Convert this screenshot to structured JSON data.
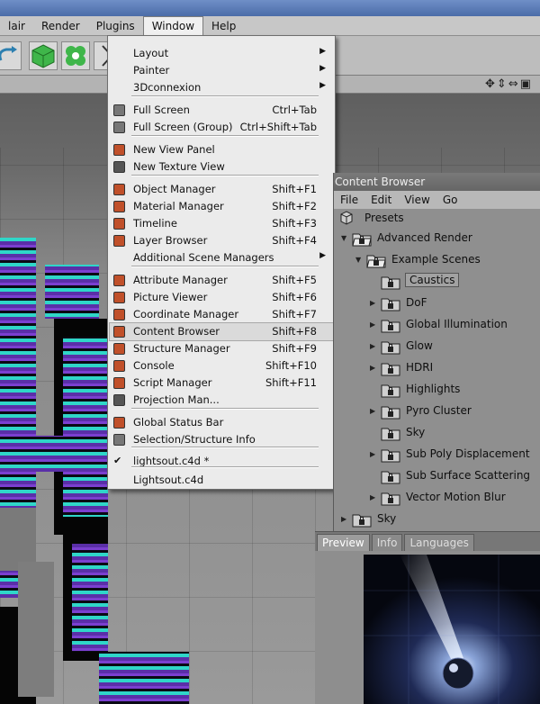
{
  "menubar": {
    "items": [
      "lair",
      "Render",
      "Plugins",
      "Window",
      "Help"
    ],
    "active": "Window"
  },
  "window_menu": {
    "items": [
      {
        "label": "Layout",
        "shortcut": "",
        "submenu": true,
        "icon": ""
      },
      {
        "label": "Painter",
        "shortcut": "",
        "submenu": true,
        "icon": ""
      },
      {
        "label": "3Dconnexion",
        "shortcut": "",
        "submenu": true,
        "icon": ""
      },
      {
        "label": "Full Screen",
        "shortcut": "Ctrl+Tab",
        "submenu": false,
        "icon": "fullscreen-icon"
      },
      {
        "label": "Full Screen (Group)",
        "shortcut": "Ctrl+Shift+Tab",
        "submenu": false,
        "icon": "fullscreen-group-icon"
      },
      {
        "label": "New View Panel",
        "shortcut": "",
        "submenu": false,
        "icon": "view-panel-icon"
      },
      {
        "label": "New Texture View",
        "shortcut": "",
        "submenu": false,
        "icon": "texture-view-icon"
      },
      {
        "label": "Object Manager",
        "shortcut": "Shift+F1",
        "submenu": false,
        "icon": "object-manager-icon"
      },
      {
        "label": "Material Manager",
        "shortcut": "Shift+F2",
        "submenu": false,
        "icon": "material-manager-icon"
      },
      {
        "label": "Timeline",
        "shortcut": "Shift+F3",
        "submenu": false,
        "icon": "timeline-icon"
      },
      {
        "label": "Layer Browser",
        "shortcut": "Shift+F4",
        "submenu": false,
        "icon": "layer-browser-icon"
      },
      {
        "label": "Additional Scene Managers",
        "shortcut": "",
        "submenu": true,
        "icon": ""
      },
      {
        "label": "Attribute Manager",
        "shortcut": "Shift+F5",
        "submenu": false,
        "icon": "attribute-manager-icon"
      },
      {
        "label": "Picture Viewer",
        "shortcut": "Shift+F6",
        "submenu": false,
        "icon": "picture-viewer-icon"
      },
      {
        "label": "Coordinate Manager",
        "shortcut": "Shift+F7",
        "submenu": false,
        "icon": "coordinate-manager-icon"
      },
      {
        "label": "Content Browser",
        "shortcut": "Shift+F8",
        "submenu": false,
        "icon": "content-browser-icon"
      },
      {
        "label": "Structure Manager",
        "shortcut": "Shift+F9",
        "submenu": false,
        "icon": "structure-manager-icon"
      },
      {
        "label": "Console",
        "shortcut": "Shift+F10",
        "submenu": false,
        "icon": "console-icon"
      },
      {
        "label": "Script Manager",
        "shortcut": "Shift+F11",
        "submenu": false,
        "icon": "script-manager-icon"
      },
      {
        "label": "Projection Man...",
        "shortcut": "",
        "submenu": false,
        "icon": "projection-man-icon"
      },
      {
        "label": "Global Status Bar",
        "shortcut": "",
        "submenu": false,
        "icon": "status-bar-icon"
      },
      {
        "label": "Selection/Structure Info",
        "shortcut": "",
        "submenu": false,
        "icon": "selection-info-icon"
      },
      {
        "label": "lightsout.c4d *",
        "shortcut": "",
        "submenu": false,
        "icon": "checkmark-icon"
      },
      {
        "label": "Lightsout.c4d",
        "shortcut": "",
        "submenu": false,
        "icon": ""
      }
    ],
    "highlighted": "Content Browser"
  },
  "content_browser": {
    "title": "Content Browser",
    "menu": [
      "File",
      "Edit",
      "View",
      "Go"
    ],
    "tree": [
      {
        "label": "Presets",
        "expander": "",
        "selected": false
      },
      {
        "label": "Advanced Render",
        "expander": "▼",
        "selected": false
      },
      {
        "label": "Example Scenes",
        "expander": "▼",
        "selected": false
      },
      {
        "label": "Caustics",
        "expander": "",
        "selected": true
      },
      {
        "label": "DoF",
        "expander": "▶",
        "selected": false
      },
      {
        "label": "Global Illumination",
        "expander": "▶",
        "selected": false
      },
      {
        "label": "Glow",
        "expander": "▶",
        "selected": false
      },
      {
        "label": "HDRI",
        "expander": "▶",
        "selected": false
      },
      {
        "label": "Highlights",
        "expander": "",
        "selected": false
      },
      {
        "label": "Pyro Cluster",
        "expander": "▶",
        "selected": false
      },
      {
        "label": "Sky",
        "expander": "",
        "selected": false
      },
      {
        "label": "Sub Poly Displacement",
        "expander": "▶",
        "selected": false
      },
      {
        "label": "Sub Surface Scattering",
        "expander": "",
        "selected": false
      },
      {
        "label": "Vector Motion Blur",
        "expander": "▶",
        "selected": false
      },
      {
        "label": "Sky",
        "expander": "▶",
        "selected": false
      }
    ]
  },
  "preview_tabs": [
    "Preview",
    "Info",
    "Languages"
  ],
  "active_preview_tab": "Preview",
  "colors": {
    "menu_bg": "#ebebeb",
    "highlight": "#dadada",
    "extrude_purple": "#5a2fa8",
    "extrude_cyan": "#2fd6c8"
  }
}
